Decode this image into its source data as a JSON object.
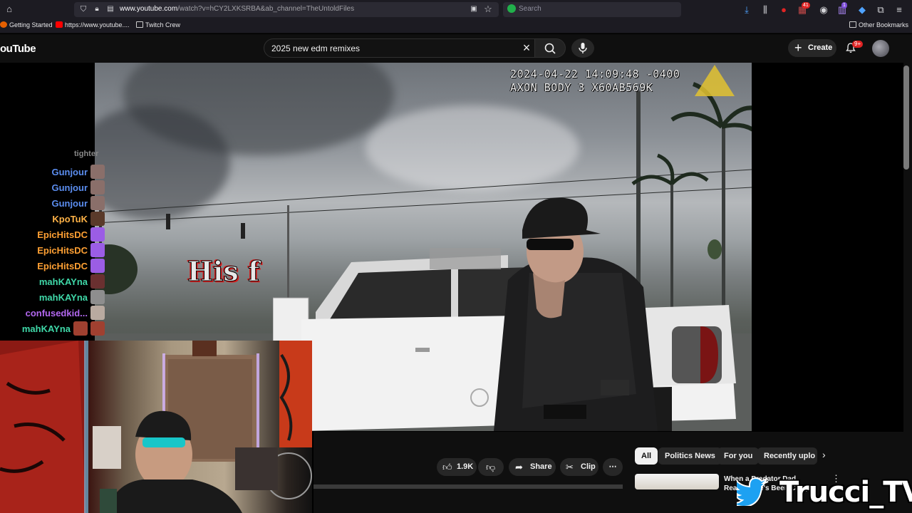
{
  "browser": {
    "url_prefix": "www.youtube.com",
    "url_rest": "/watch?v=hCY2LXKSRBA&ab_channel=TheUntoldFiles",
    "search_placeholder": "Search",
    "bookmarks": [
      "Getting Started",
      "https://www.youtube....",
      "Twitch Crew"
    ],
    "other_bookmarks": "Other Bookmarks",
    "badge_ext1": "41",
    "badge_ext2": "1"
  },
  "youtube": {
    "logo": "ouTube",
    "search_query": "2025 new edm remixes",
    "create_label": "Create",
    "notifications_badge": "9+",
    "accent_color": "#ff0000"
  },
  "video": {
    "timestamp": "2024-04-22 14:09:48 -0400",
    "device": "AXON BODY 3 X60AB569K",
    "caption": "His f"
  },
  "actions": {
    "likes": "1.9K",
    "share": "Share",
    "clip": "Clip",
    "more": "⋯"
  },
  "chips": [
    "All",
    "Politics News",
    "For you",
    "Recently uplo"
  ],
  "recommendation": {
    "title": "When a Predator Dad Realizes He's Been Caught"
  },
  "chat": {
    "fragment": "tighter",
    "messages": [
      {
        "user": "Gunjour",
        "color": "#5b8def"
      },
      {
        "user": "Gunjour",
        "color": "#5b8def"
      },
      {
        "user": "Gunjour",
        "color": "#5b8def"
      },
      {
        "user": "KpoTuK",
        "color": "#ffb347"
      },
      {
        "user": "EpicHitsDC",
        "color": "#ffa033"
      },
      {
        "user": "EpicHitsDC",
        "color": "#ffa033"
      },
      {
        "user": "EpicHitsDC",
        "color": "#ffa033"
      },
      {
        "user": "mahKAYna",
        "color": "#3fd8a8"
      },
      {
        "user": "mahKAYna",
        "color": "#3fd8a8"
      },
      {
        "user": "confusedkid...",
        "color": "#b368f0"
      },
      {
        "user": "mahKAYna",
        "color": "#3fd8a8"
      }
    ]
  },
  "watermark": {
    "handle": "Trucci_TV"
  }
}
